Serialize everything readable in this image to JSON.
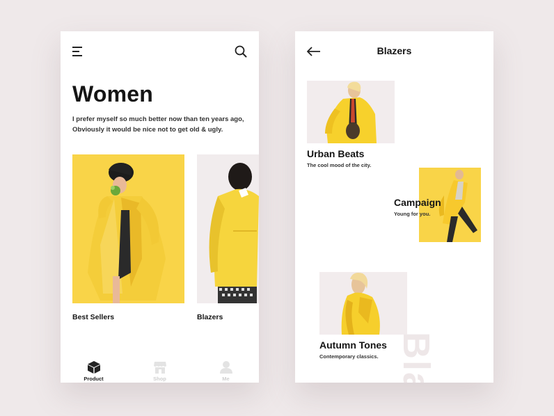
{
  "left": {
    "title": "Women",
    "intro": "I prefer myself so much better now than ten years ago, Obviously it would be nice not to get old & ugly.",
    "cards": [
      {
        "label": "Best Sellers"
      },
      {
        "label": "Blazers"
      }
    ],
    "nav": [
      {
        "label": "Product",
        "icon": "box-icon",
        "active": true
      },
      {
        "label": "Shop",
        "icon": "store-icon",
        "active": false
      },
      {
        "label": "Me",
        "icon": "user-icon",
        "active": false
      }
    ]
  },
  "right": {
    "title": "Blazers",
    "features": [
      {
        "title": "Urban Beats",
        "subtitle": "The cool mood of the city."
      },
      {
        "title": "Campaign",
        "subtitle": "Young for you."
      },
      {
        "title": "Autumn Tones",
        "subtitle": "Contemporary classics."
      }
    ],
    "background_word": "Bla"
  },
  "colors": {
    "background": "#efe9ea",
    "accent_yellow": "#f9d448",
    "text": "#151515",
    "muted": "#cfcfcf"
  }
}
